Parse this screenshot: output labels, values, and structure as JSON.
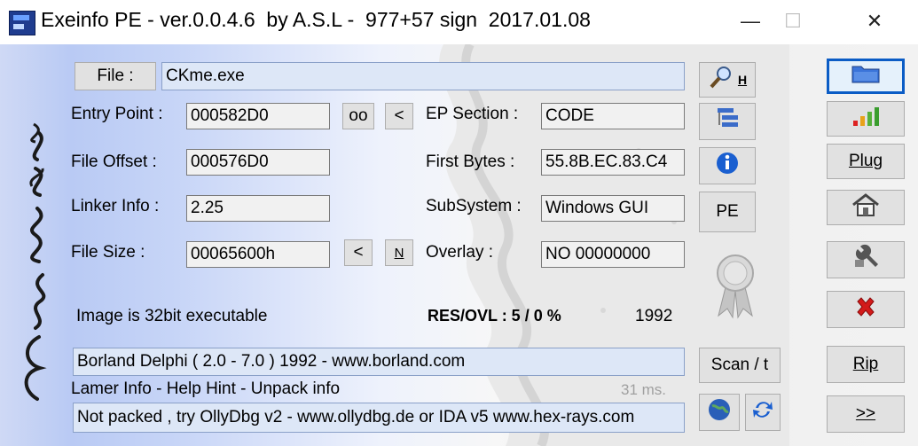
{
  "window": {
    "title": "Exeinfo PE - ver.0.0.4.6  by A.S.L -  977+57 sign  2017.01.08",
    "minimize_glyph": "—",
    "maximize_glyph": "☐",
    "close_glyph": "✕"
  },
  "file": {
    "button_label": "File :",
    "value": "CKme.exe"
  },
  "fields": {
    "entry_point": {
      "label": "Entry Point :",
      "value": "000582D0"
    },
    "file_offset": {
      "label": "File Offset :",
      "value": "000576D0"
    },
    "linker_info": {
      "label": "Linker Info :",
      "value": "2.25"
    },
    "file_size": {
      "label": "File Size :",
      "value": "00065600h"
    },
    "ep_section": {
      "label": "EP Section :",
      "value": "CODE"
    },
    "first_bytes": {
      "label": "First Bytes :",
      "value": "55.8B.EC.83.C4"
    },
    "subsystem": {
      "label": "SubSystem :",
      "value": "Windows GUI"
    },
    "overlay": {
      "label": "Overlay :",
      "value": "NO   00000000"
    }
  },
  "small_buttons": {
    "oo": "oo",
    "lt1": "<",
    "lt2": "<",
    "n": "N"
  },
  "image_info": "Image is 32bit executable",
  "res_ovl": "RES/OVL : 5 / 0 %",
  "year": "1992",
  "detection": "Borland Delphi ( 2.0 - 7.0 ) 1992 - www.borland.com",
  "lamer_info": "Lamer Info - Help Hint - Unpack info",
  "timing": "31 ms.",
  "hint": "Not packed , try OllyDbg v2 - www.ollydbg.de or IDA v5 www.hex-rays.com",
  "middle_buttons": {
    "h_label": "H",
    "pe": "PE",
    "scan": "Scan / t"
  },
  "right_buttons": {
    "plug": "Plug",
    "rip": "Rip",
    "more": ">>"
  },
  "icons": [
    "magnifier-icon",
    "tree-icon",
    "info-icon",
    "ribbon-icon",
    "folder-icon",
    "bars-chart-icon",
    "home-icon",
    "wrench-icon",
    "red-x-icon",
    "globe-icon",
    "refresh-icon"
  ],
  "colors": {
    "info_blue": "#1a5fd0",
    "close_red": "#d21a1a"
  }
}
